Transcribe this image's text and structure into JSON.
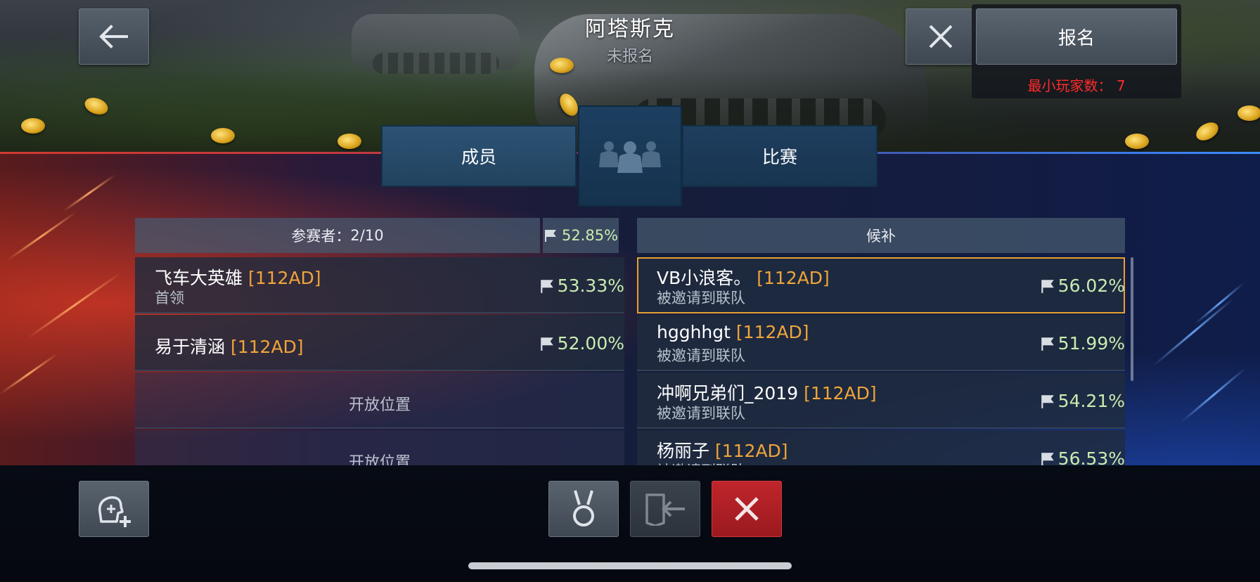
{
  "header": {
    "title": "阿塔斯克",
    "status": "未报名"
  },
  "signup": {
    "button_label": "报名",
    "min_players_label": "最小玩家数：",
    "min_players_value": "7"
  },
  "tabs": [
    {
      "label": "成员",
      "active": true
    },
    {
      "label": "比赛",
      "active": false
    }
  ],
  "participants": {
    "header_label": "参赛者：",
    "header_count": "2/10",
    "header_rate": "52.85%",
    "rows": [
      {
        "name": "飞车大英雄",
        "tag": "[112AD]",
        "sub": "首领",
        "rate": "53.33%"
      },
      {
        "name": "易于清涵",
        "tag": "[112AD]",
        "sub": "",
        "rate": "52.00%"
      }
    ],
    "open_slots": [
      "开放位置",
      "开放位置"
    ]
  },
  "reserves": {
    "header_label": "候补",
    "rows": [
      {
        "name": "VB小浪客。",
        "tag": "[112AD]",
        "sub": "被邀请到联队",
        "rate": "56.02%",
        "selected": true
      },
      {
        "name": "hgghhgt",
        "tag": "[112AD]",
        "sub": "被邀请到联队",
        "rate": "51.99%"
      },
      {
        "name": "冲啊兄弟们_2019",
        "tag": "[112AD]",
        "sub": "被邀请到联队",
        "rate": "54.21%"
      },
      {
        "name": "杨丽子",
        "tag": "[112AD]",
        "sub": "被邀请到联队",
        "rate": "56.53%"
      }
    ]
  },
  "icons": {
    "back": "arrow-left-icon",
    "close": "close-icon",
    "team": "team-icon",
    "flag": "flag-icon",
    "invite": "add-player-icon",
    "medal": "medal-icon",
    "leave": "exit-door-icon",
    "disband": "close-icon"
  },
  "colors": {
    "clan_tag": "#f0a43a",
    "win_rate": "#c9ecb0",
    "min_players": "#ff2a2a",
    "danger_button": "#c0252a",
    "selected_outline": "#e6a130"
  }
}
